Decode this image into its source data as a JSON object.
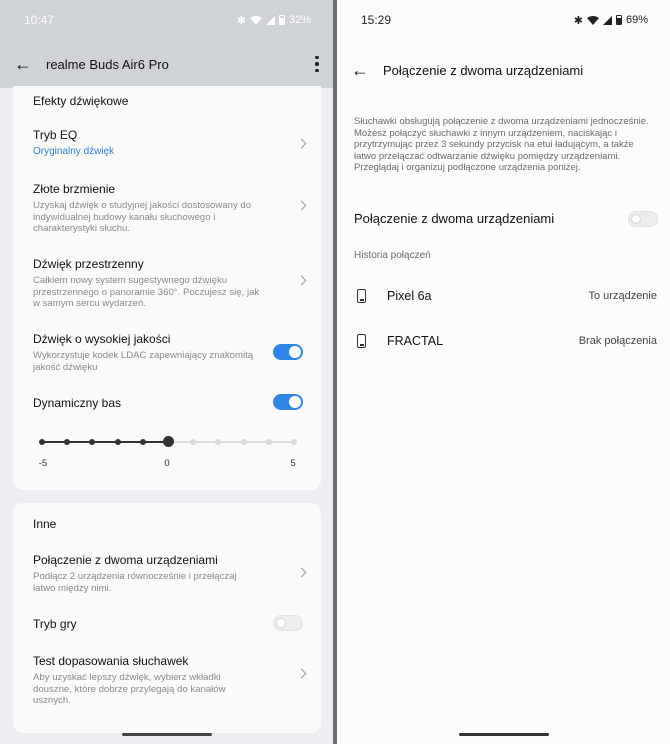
{
  "left": {
    "status": {
      "time": "10:47",
      "battery": "32%"
    },
    "appbar": {
      "title": "realme Buds Air6 Pro"
    },
    "sound_effects": {
      "title": "Efekty dźwiękowe",
      "eq": {
        "title": "Tryb EQ",
        "value": "Oryginalny dźwięk"
      },
      "golden": {
        "title": "Złote brzmienie",
        "desc": "Uzyskaj dźwięk o studyjnej jakości dostosowany do indywidualnej budowy kanału słuchowego i charakterystyki słuchu."
      },
      "spatial": {
        "title": "Dźwięk przestrzenny",
        "desc": "Całkiem nowy system sugestywnego dźwięku przestrzennego o panoramie 360°. Poczujesz się, jak w samym sercu wydarzeń."
      },
      "hires": {
        "title": "Dźwięk o wysokiej jakości",
        "desc": "Wykorzystuje kodek LDAC zapewniający znakomitą jakość dźwięku",
        "enabled": true
      },
      "bass": {
        "title": "Dynamiczny bas",
        "enabled": true,
        "min": -5,
        "max": 5,
        "value": 0,
        "tick_min": "-5",
        "tick_mid": "0",
        "tick_max": "5"
      }
    },
    "other": {
      "title": "Inne",
      "dual": {
        "title": "Połączenie z dwoma urządzeniami",
        "desc": "Podłącz 2 urządzenia równocześnie i przełączaj łatwo między nimi."
      },
      "game": {
        "title": "Tryb gry",
        "enabled": false
      },
      "fit": {
        "title": "Test dopasowania słuchawek",
        "desc": "Aby uzyskać lepszy dźwięk, wybierz wkładki douszne, które dobrze przylegają do kanałów usznych."
      }
    }
  },
  "right": {
    "status": {
      "time": "15:29",
      "battery": "69%"
    },
    "appbar": {
      "title": "Połączenie z dwoma urządzeniami"
    },
    "description": "Słuchawki obsługują połączenie z dwoma urządzeniami jednocześnie. Możesz połączyć słuchawki z innym urządzeniem, naciskając i przytrzymując przez 3 sekundy przycisk na etui ładującym, a także łatwo przełączać odtwarzanie dźwięku pomiędzy urządzeniami. Przeglądaj i organizuj podłączone urządzenia poniżej.",
    "toggle": {
      "label": "Połączenie z dwoma urządzeniami",
      "enabled": false
    },
    "history_label": "Historia połączeń",
    "devices": [
      {
        "name": "Pixel 6a",
        "status": "To urządzenie"
      },
      {
        "name": "FRACTAL",
        "status": "Brak połączenia"
      }
    ]
  }
}
